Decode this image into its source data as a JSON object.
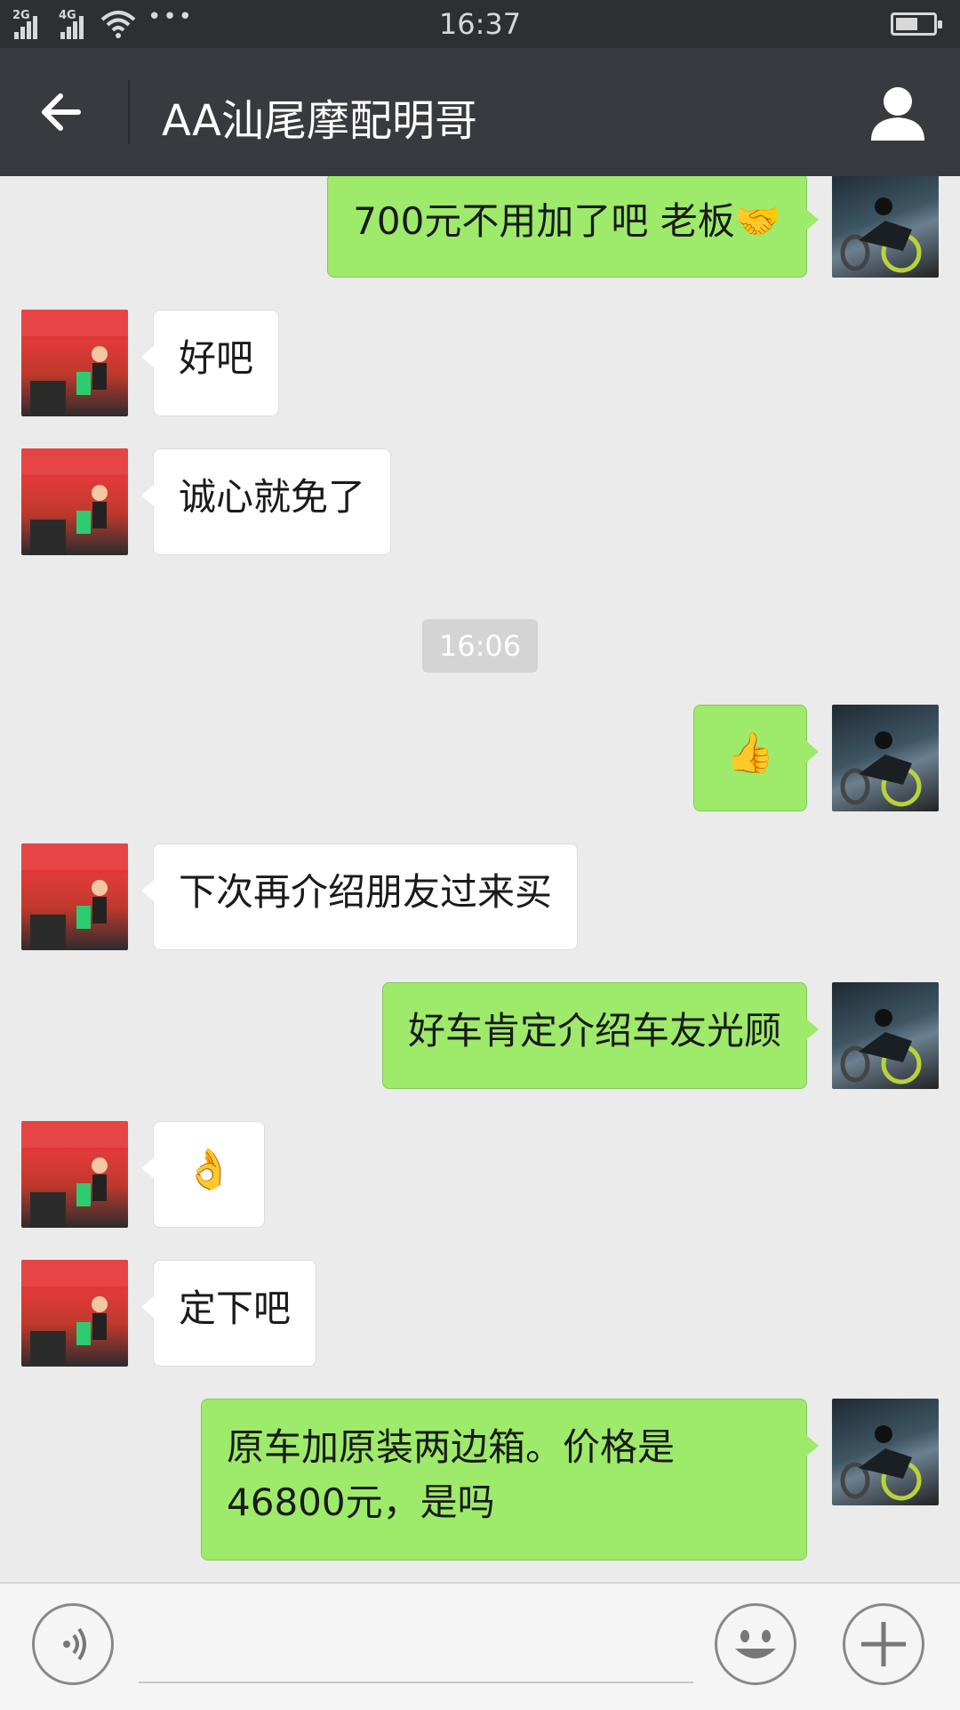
{
  "status_bar": {
    "sim1_label": "2G",
    "sim2_label": "4G",
    "more_indicator": "•••",
    "time": "16:37",
    "battery_level": 0.6
  },
  "header": {
    "title": "AA汕尾摩配明哥",
    "back_icon": "arrow-left-icon",
    "profile_icon": "person-icon"
  },
  "messages": [
    {
      "from": "me",
      "text": "700元不用加了吧   老板🤝"
    },
    {
      "from": "other",
      "text": "好吧"
    },
    {
      "from": "other",
      "text": "诚心就免了"
    },
    {
      "type": "time",
      "text": "16:06"
    },
    {
      "from": "me",
      "text": "👍"
    },
    {
      "from": "other",
      "text": "下次再介绍朋友过来买"
    },
    {
      "from": "me",
      "text": "好车肯定介绍车友光顾"
    },
    {
      "from": "other",
      "text": "👌"
    },
    {
      "from": "other",
      "text": "定下吧"
    },
    {
      "from": "me",
      "text": "原车加原装两边箱。价格是46800元，是吗"
    }
  ],
  "input_bar": {
    "voice_icon": "voice-icon",
    "emoji_icon": "smiley-icon",
    "add_icon": "plus-icon",
    "text_value": ""
  },
  "colors": {
    "my_bubble": "#9eea6a",
    "other_bubble": "#ffffff",
    "title_bar": "#393a3f",
    "chat_bg": "#ebebeb"
  }
}
